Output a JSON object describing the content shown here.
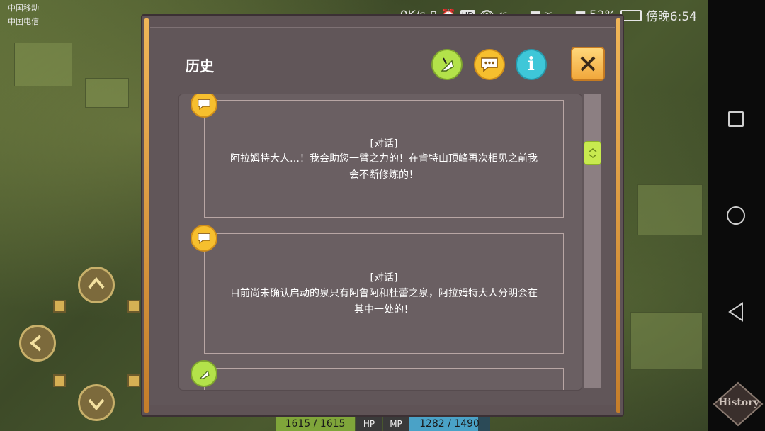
{
  "statusbar": {
    "carrier_1": "中国移动",
    "carrier_2": "中国电信",
    "net_speed": "0K/s",
    "battery": "52%",
    "time": "傍晚6:54",
    "signal_1": "4G",
    "signal_2": "2G"
  },
  "dialog": {
    "title": "历史",
    "buttons": {
      "quill_icon": "quill-icon",
      "chat_icon": "chat-bubble-icon",
      "info_label": "i",
      "close_icon": "close-icon"
    }
  },
  "history": {
    "entries": [
      {
        "kind": "[对话]",
        "line_1": "阿拉姆特大人…！我会助您一臂之力的！在肯特山顶峰再次相见之前我",
        "line_2": "会不断修炼的！",
        "icon": "chat-bubble-icon"
      },
      {
        "kind": "[对话]",
        "line_1": "目前尚未确认启动的泉只有阿鲁阿和杜蕾之泉，阿拉姆特大人分明会在",
        "line_2": "其中一处的！",
        "icon": "chat-bubble-icon"
      },
      {
        "icon": "quill-icon"
      }
    ]
  },
  "hud": {
    "hp_value": "1615 / 1615",
    "hp_label": "HP",
    "mp_label": "MP",
    "mp_value": "1282 / 1490",
    "history_button": "History"
  },
  "colors": {
    "accent_green": "#b3e24a",
    "accent_yellow": "#f6bf2e",
    "accent_cyan": "#3ec7d8",
    "panel_bg": "#5f5356"
  }
}
